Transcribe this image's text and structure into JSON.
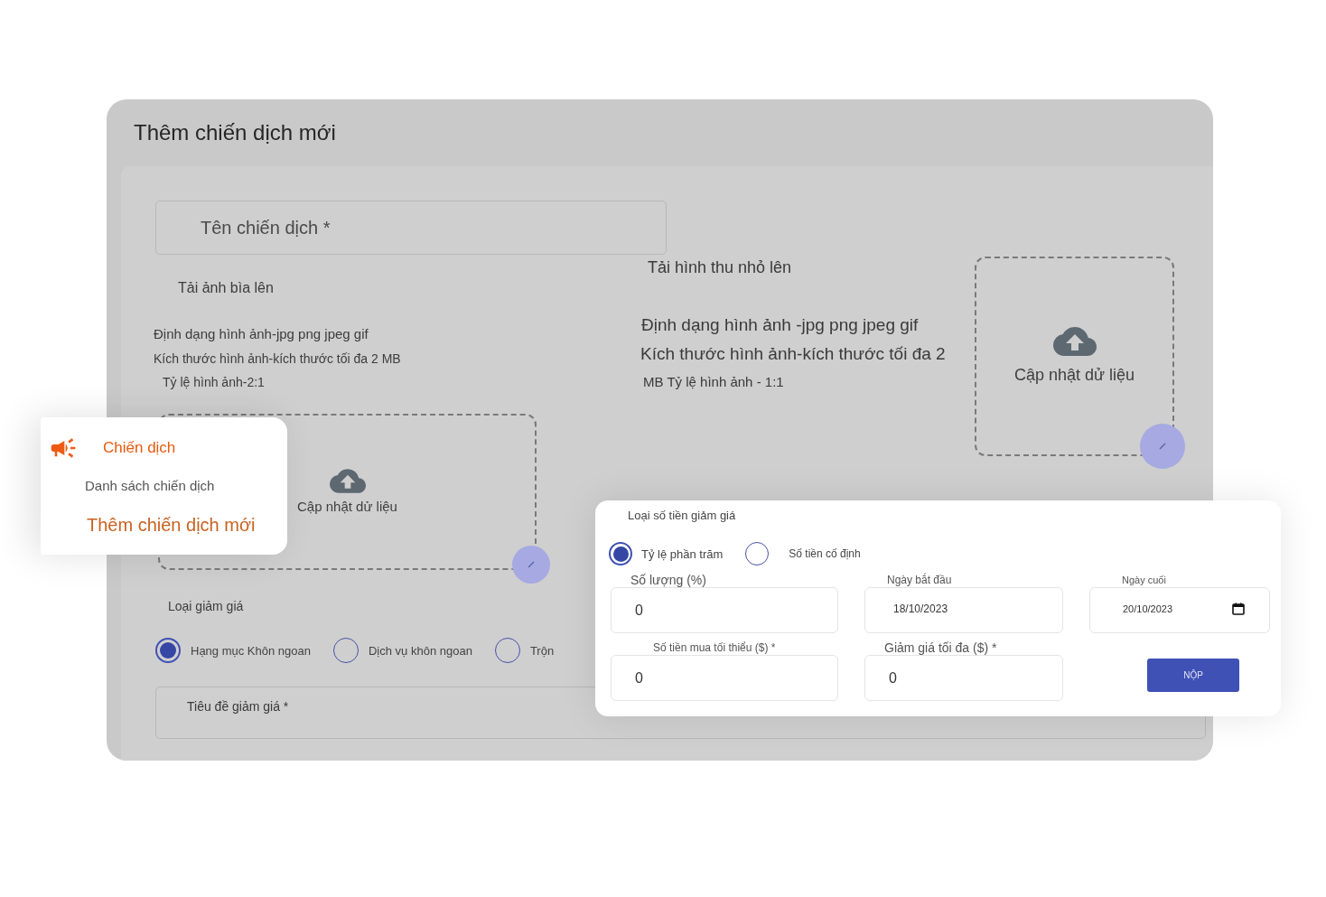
{
  "page": {
    "title": "Thêm chiến dịch mới"
  },
  "campaign_form": {
    "name_field": {
      "placeholder": "Tên chiến dịch *"
    },
    "cover_upload": {
      "title": "Tải ảnh bìa lên",
      "notes": [
        "Định dạng hình ảnh-jpg png jpeg gif",
        "Kích thước hình ảnh-kích thước tối đa 2 MB",
        "Tỷ lệ hình ảnh-2:1"
      ],
      "dropzone_label": "Cập nhật dử liệu"
    },
    "thumbnail_upload": {
      "title": "Tải hình thu nhỏ lên",
      "notes": [
        "Định dạng hình ảnh -jpg png jpeg gif",
        "Kích thước hình ảnh-kích thước tối đa 2",
        "MB Tỷ lệ hình ảnh - 1:1"
      ],
      "dropzone_label": "Cập nhật dử liệu"
    },
    "discount_type": {
      "label": "Loại giảm giá",
      "options": [
        {
          "label": "Hạng mục Khôn ngoan",
          "selected": true
        },
        {
          "label": "Dịch vụ khôn ngoan",
          "selected": false
        },
        {
          "label": "Trộn",
          "selected": false
        }
      ]
    },
    "discount_title_field": {
      "placeholder": "Tiêu đề giảm giá *"
    }
  },
  "campaign_menu": {
    "title": "Chiến dịch",
    "items": [
      {
        "label": "Danh sách chiến dịch",
        "selected": false
      },
      {
        "label": "Thêm chiến dịch mới",
        "selected": true
      }
    ]
  },
  "discount_amount_panel": {
    "amount_type": {
      "label": "Loại số tiền giảm giá",
      "options": [
        {
          "label": "Tỷ lệ phần trăm",
          "selected": true
        },
        {
          "label": "Số tiền cố định",
          "selected": false
        }
      ]
    },
    "fields": [
      {
        "label": "Số lượng (%)",
        "value": "0",
        "kind": "number"
      },
      {
        "label": "Ngày bắt đầu",
        "value": "18/10/2023",
        "kind": "date"
      },
      {
        "label": "Ngày cuối",
        "value": "20/10/2023",
        "kind": "date_picker"
      },
      {
        "label": "Số tiền mua tối thiểu ($) *",
        "value": "0",
        "kind": "number"
      },
      {
        "label": "Giảm giá tối đa ($) *",
        "value": "0",
        "kind": "number"
      }
    ],
    "submit_button": "NỘP"
  }
}
